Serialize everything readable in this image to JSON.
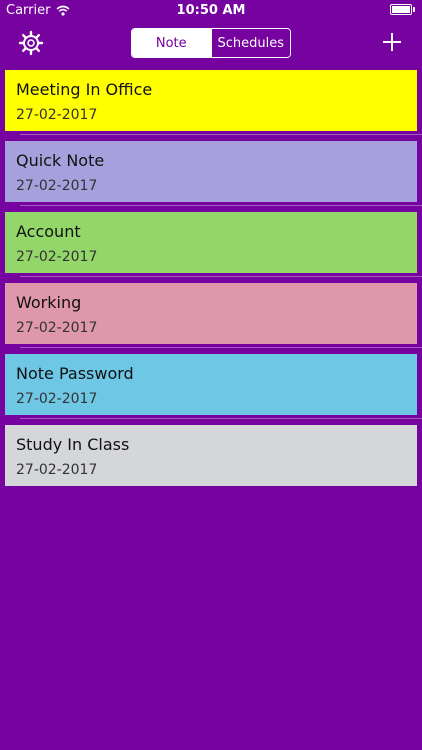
{
  "status_bar": {
    "carrier": "Carrier",
    "time": "10:50 AM"
  },
  "navbar": {
    "left_icon": "gear-icon",
    "right_icon": "plus-icon",
    "segments": [
      {
        "label": "Note",
        "selected": true
      },
      {
        "label": "Schedules",
        "selected": false
      }
    ]
  },
  "notes": [
    {
      "title": "Meeting In Office",
      "date": "27-02-2017",
      "color": "#ffff00"
    },
    {
      "title": "Quick Note",
      "date": "27-02-2017",
      "color": "#a6a0dc"
    },
    {
      "title": "Account",
      "date": "27-02-2017",
      "color": "#93d76a"
    },
    {
      "title": "Working",
      "date": "27-02-2017",
      "color": "#de97ab"
    },
    {
      "title": "Note Password",
      "date": "27-02-2017",
      "color": "#6fc7e6"
    },
    {
      "title": "Study In Class",
      "date": "27-02-2017",
      "color": "#d4d6da"
    }
  ],
  "colors": {
    "background": "#76029f",
    "foreground": "#ffffff"
  }
}
